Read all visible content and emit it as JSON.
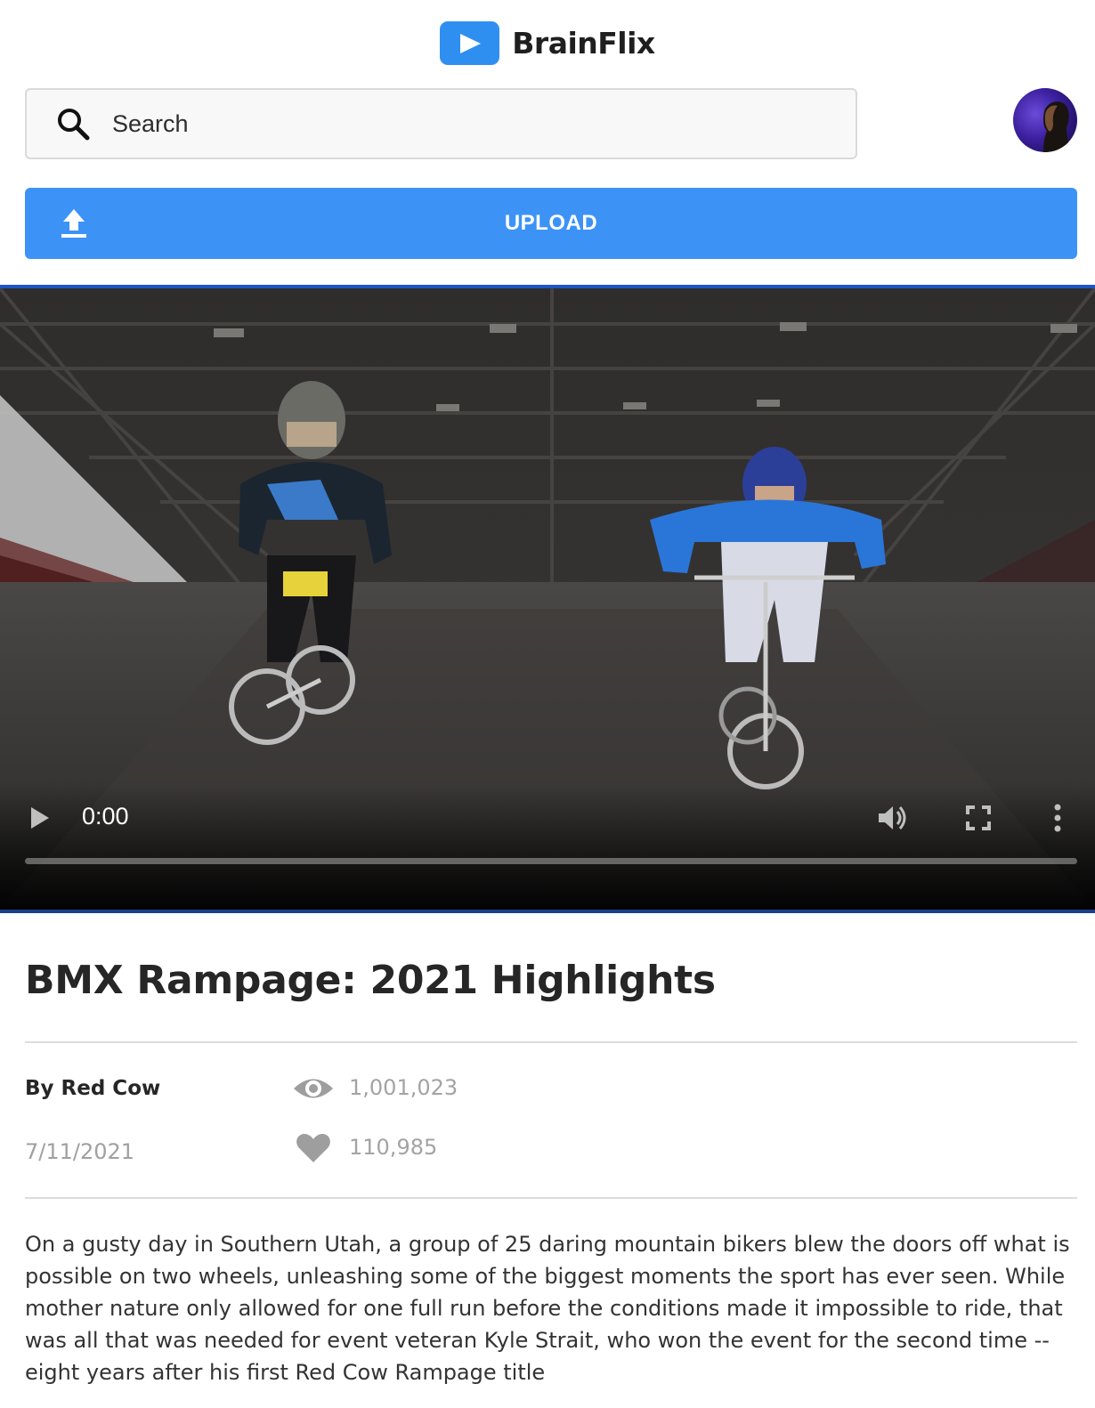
{
  "app": {
    "name": "BrainFlix"
  },
  "search": {
    "placeholder": "Search",
    "value": ""
  },
  "upload": {
    "label": "UPLOAD"
  },
  "player": {
    "time": "0:00",
    "progress": 0
  },
  "video": {
    "title": "BMX Rampage: 2021 Highlights",
    "author": "By Red Cow",
    "date": "7/11/2021",
    "views": "1,001,023",
    "likes": "110,985",
    "description": "On a gusty day in Southern Utah, a group of 25 daring mountain bikers blew the doors off what is possible on two wheels, unleashing some of the biggest moments the sport has ever seen. While mother nature only allowed for one full run before the conditions made it impossible to ride, that was all that was needed for event veteran Kyle Strait, who won the event for the second time -- eight years after his first Red Cow Rampage title"
  },
  "colors": {
    "accent": "#3d93f5",
    "logo": "#2f8ff0",
    "player_border": "#1c55c8"
  },
  "icons": {
    "logo": "play-icon",
    "search": "search-icon",
    "upload": "upload-icon",
    "views": "eye-icon",
    "likes": "heart-icon",
    "play": "play-icon",
    "volume": "volume-icon",
    "fullscreen": "fullscreen-icon",
    "more": "more-vertical-icon"
  }
}
